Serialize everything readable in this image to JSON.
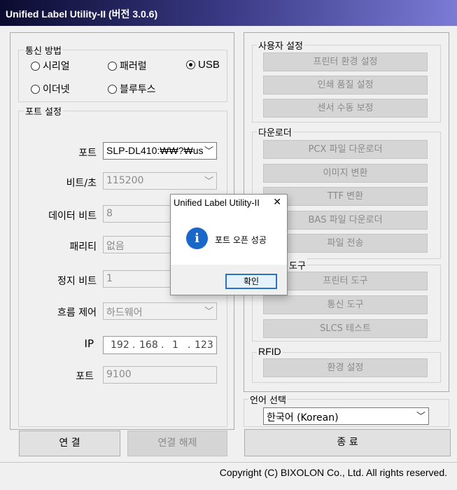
{
  "window": {
    "title": "Unified Label Utility-II (버전 3.0.6)"
  },
  "comm": {
    "title": "통신 방법",
    "options": [
      {
        "label": "시리얼",
        "selected": false
      },
      {
        "label": "패러럴",
        "selected": false
      },
      {
        "label": "USB",
        "selected": true
      },
      {
        "label": "이더넷",
        "selected": false
      },
      {
        "label": "블루투스",
        "selected": false
      }
    ]
  },
  "port": {
    "title": "포트 설정",
    "fields": [
      {
        "label": "포트",
        "value": "SLP-DL410:₩₩?₩us"
      },
      {
        "label": "비트/초",
        "value": "115200"
      },
      {
        "label": "데이터 비트",
        "value": "8"
      },
      {
        "label": "패리티",
        "value": "없음"
      },
      {
        "label": "정지 비트",
        "value": "1"
      },
      {
        "label": "흐름 제어",
        "value": "하드웨어"
      }
    ],
    "ip": {
      "label": "IP",
      "octets": [
        "192",
        "168",
        "1",
        "123"
      ]
    },
    "tcp_port": {
      "label": "포트",
      "value": "9100"
    }
  },
  "buttons": {
    "connect": "연 결",
    "disconnect": "연결 해제",
    "exit": "종 료"
  },
  "user_settings": {
    "title": "사용자 설정",
    "items": [
      "프린터 환경 설정",
      "인쇄 품질 설정",
      "센서 수동 보정"
    ]
  },
  "downloader": {
    "title": "다운로더",
    "items": [
      "PCX 파일 다운로더",
      "이미지 변환",
      "TTF 변환",
      "BAS 파일 다운로더",
      "파일 전송"
    ]
  },
  "tools": {
    "title": "도구",
    "items": [
      "프린터 도구",
      "통신 도구",
      "SLCS 테스트"
    ]
  },
  "rfid": {
    "title": "RFID",
    "items": [
      "환경 설정"
    ]
  },
  "language": {
    "title": "언어 선택",
    "value": "한국어 (Korean)"
  },
  "dialog": {
    "title": "Unified Label Utility-II",
    "message": "포트 오픈 성공",
    "ok": "확인",
    "close": "✕",
    "icon": "info-icon"
  },
  "footer": {
    "copyright": "Copyright (C) BIXOLON Co., Ltd. All rights reserved."
  },
  "colors": {
    "info_icon": "#1b66c9",
    "ok_border": "#2a72c8"
  }
}
